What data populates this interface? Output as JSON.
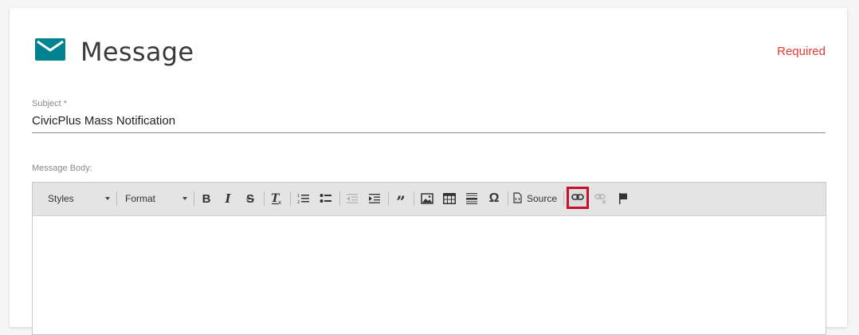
{
  "header": {
    "title": "Message",
    "icon": "envelope-icon",
    "required_label": "Required",
    "accent_color": "#00838f",
    "required_color": "#e53935"
  },
  "subject": {
    "label": "Subject *",
    "value": "CivicPlus Mass Notification"
  },
  "message_body": {
    "label": "Message Body:",
    "toolbar": {
      "styles_label": "Styles",
      "format_label": "Format",
      "source_label": "Source",
      "buttons": [
        "bold-icon",
        "italic-icon",
        "strikethrough-icon",
        "remove-format-icon",
        "numbered-list-icon",
        "bulleted-list-icon",
        "outdent-icon",
        "indent-icon",
        "blockquote-icon",
        "image-icon",
        "table-icon",
        "horizontal-line-icon",
        "special-char-icon",
        "source-icon",
        "link-icon",
        "unlink-icon",
        "anchor-icon"
      ],
      "highlighted_button": "link-icon",
      "highlight_color": "#c8102e"
    },
    "content": ""
  }
}
